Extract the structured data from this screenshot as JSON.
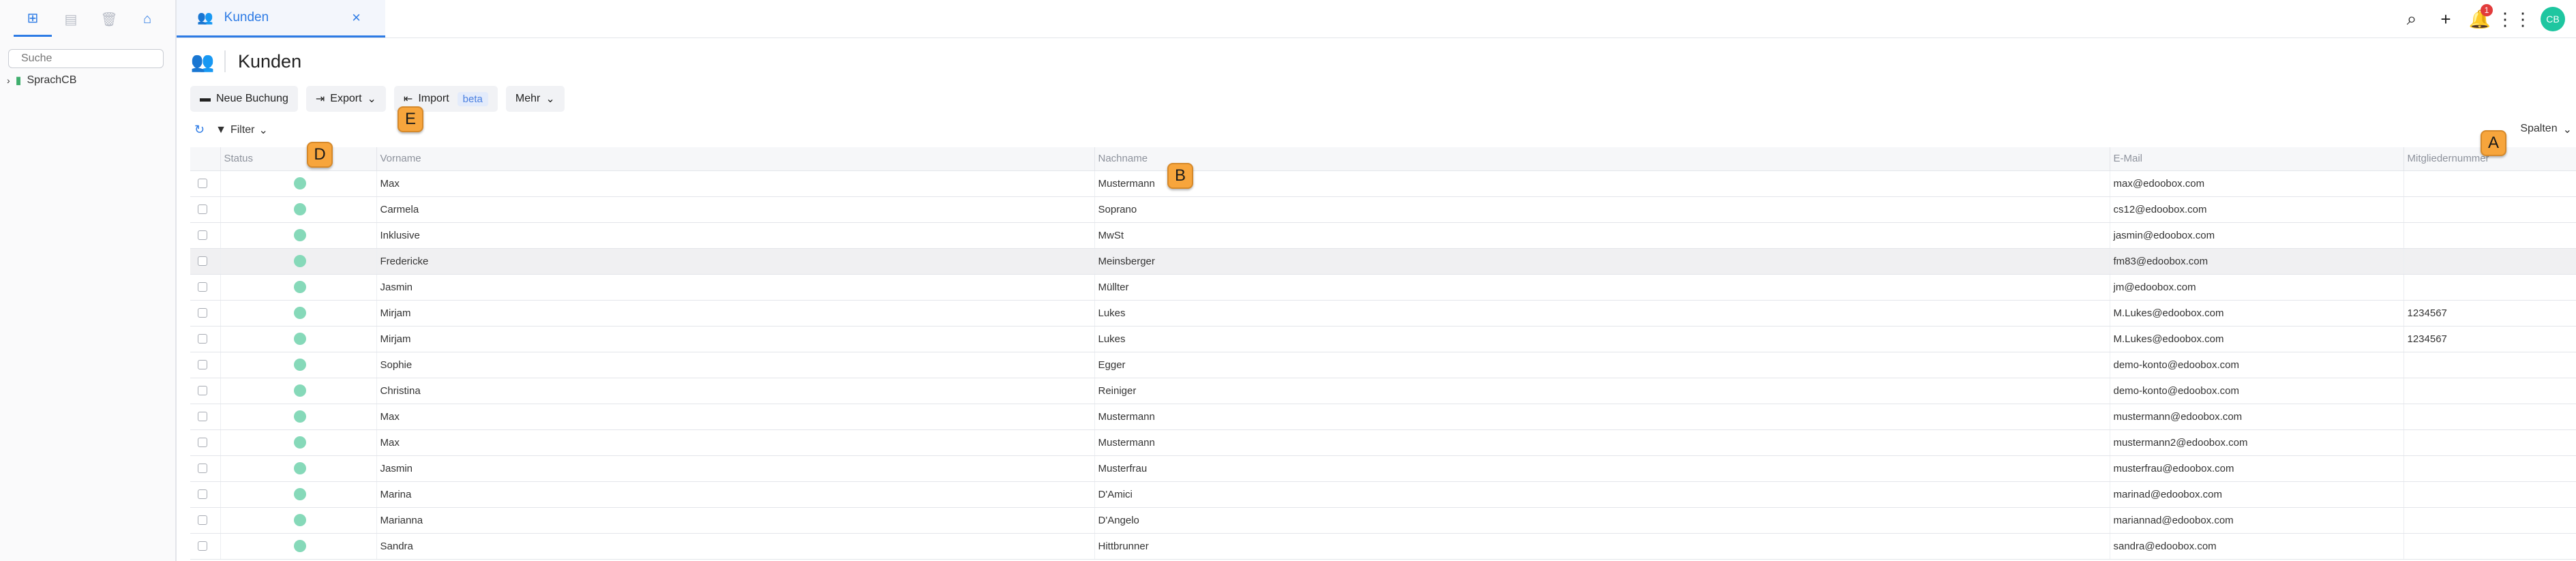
{
  "sidebar": {
    "search_placeholder": "Suche",
    "tree_item": "SprachCB"
  },
  "tab": {
    "label": "Kunden"
  },
  "topbar": {
    "notification_count": "1",
    "avatar_initials": "CB"
  },
  "page": {
    "title": "Kunden"
  },
  "toolbar": {
    "new_booking": "Neue Buchung",
    "export": "Export",
    "import": "Import",
    "import_badge": "beta",
    "more": "Mehr"
  },
  "filter": {
    "label": "Filter",
    "columns_label": "Spalten"
  },
  "annotations": {
    "a": "A",
    "b": "B",
    "d": "D",
    "e": "E"
  },
  "table": {
    "headers": [
      "Status",
      "Vorname",
      "Nachname",
      "E-Mail",
      "Mitgliedernummer"
    ],
    "rows": [
      {
        "first": "Max",
        "last": "Mustermann",
        "email": "max@edoobox.com",
        "member": ""
      },
      {
        "first": "Carmela",
        "last": "Soprano",
        "email": "cs12@edoobox.com",
        "member": ""
      },
      {
        "first": "Inklusive",
        "last": "MwSt",
        "email": "jasmin@edoobox.com",
        "member": ""
      },
      {
        "first": "Fredericke",
        "last": "Meinsberger",
        "email": "fm83@edoobox.com",
        "member": ""
      },
      {
        "first": "Jasmin",
        "last": "Müllter",
        "email": "jm@edoobox.com",
        "member": ""
      },
      {
        "first": "Mirjam",
        "last": "Lukes",
        "email": "M.Lukes@edoobox.com",
        "member": "1234567"
      },
      {
        "first": "Mirjam",
        "last": "Lukes",
        "email": "M.Lukes@edoobox.com",
        "member": "1234567"
      },
      {
        "first": "Sophie",
        "last": "Egger",
        "email": "demo-konto@edoobox.com",
        "member": ""
      },
      {
        "first": "Christina",
        "last": "Reiniger",
        "email": "demo-konto@edoobox.com",
        "member": ""
      },
      {
        "first": "Max",
        "last": "Mustermann",
        "email": "mustermann@edoobox.com",
        "member": ""
      },
      {
        "first": "Max",
        "last": "Mustermann",
        "email": "mustermann2@edoobox.com",
        "member": ""
      },
      {
        "first": "Jasmin",
        "last": "Musterfrau",
        "email": "musterfrau@edoobox.com",
        "member": ""
      },
      {
        "first": "Marina",
        "last": "D'Amici",
        "email": "marinad@edoobox.com",
        "member": ""
      },
      {
        "first": "Marianna",
        "last": "D'Angelo",
        "email": "mariannad@edoobox.com",
        "member": ""
      },
      {
        "first": "Sandra",
        "last": "Hittbrunner",
        "email": "sandra@edoobox.com",
        "member": ""
      }
    ]
  }
}
